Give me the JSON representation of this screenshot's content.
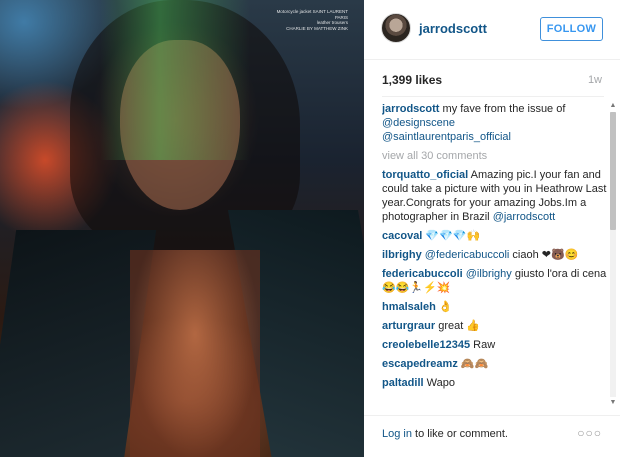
{
  "photo": {
    "credit_lines": [
      "Motorcycle jacket SAINT LAURENT PARIS",
      "leather trousers",
      "CHARLIE BY MATTHEW ZINK"
    ]
  },
  "header": {
    "username": "jarrodscott",
    "follow_label": "FOLLOW"
  },
  "stats": {
    "likes": "1,399 likes",
    "age": "1w"
  },
  "caption": {
    "user": "jarrodscott",
    "text": " my fave from the issue of ",
    "mention1": "@designscene",
    "mention2": "@saintlaurentparis_official"
  },
  "view_all": "view all 30 comments",
  "comments": [
    {
      "user": "torquatto_oficial",
      "text": " Amazing pic.I your fan and could take a picture with you in Heathrow Last year.Congrats for your amazing Jobs.Im a photographer in Brazil ",
      "mention": "@jarrodscott"
    },
    {
      "user": "cacoval",
      "text": " 💎💎💎🙌"
    },
    {
      "user": "ilbrighy",
      "mention": "@federicabuccoli",
      "text": " ciaoh ❤🐻😊"
    },
    {
      "user": "federicabuccoli",
      "mention": "@ilbrighy",
      "text": " giusto l'ora di cena 😂😂🏃⚡💥"
    },
    {
      "user": "hmalsaleh",
      "text": " 👌"
    },
    {
      "user": "arturgraur",
      "text": " great 👍"
    },
    {
      "user": "creolebelle12345",
      "text": " Raw"
    },
    {
      "user": "escapedreamz",
      "text": " 🙈🙈"
    },
    {
      "user": "paltadill",
      "text": " Wapo"
    }
  ],
  "footer": {
    "login_label": "Log in",
    "rest": " to like or comment.",
    "more": "○○○"
  }
}
